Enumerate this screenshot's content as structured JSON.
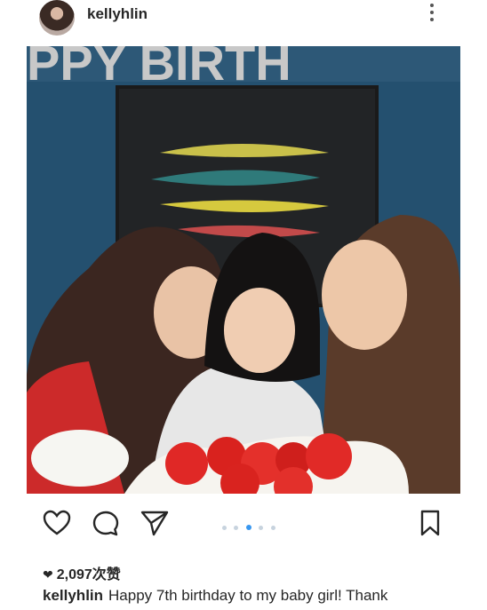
{
  "post": {
    "username": "kellyhlin",
    "likes_count": "2,097次赞",
    "caption_user": "kellyhlin",
    "caption_text": "Happy 7th birthday to my baby girl! Thank",
    "carousel": {
      "total": 5,
      "active_index": 2
    }
  },
  "photo": {
    "balloon_text": "PPY BIRTH"
  },
  "icons": {
    "like": "heart-outline-icon",
    "comment": "comment-bubble-icon",
    "share": "paper-plane-icon",
    "save": "bookmark-icon",
    "more": "more-vertical-icon",
    "liked": "heart-filled-icon"
  }
}
